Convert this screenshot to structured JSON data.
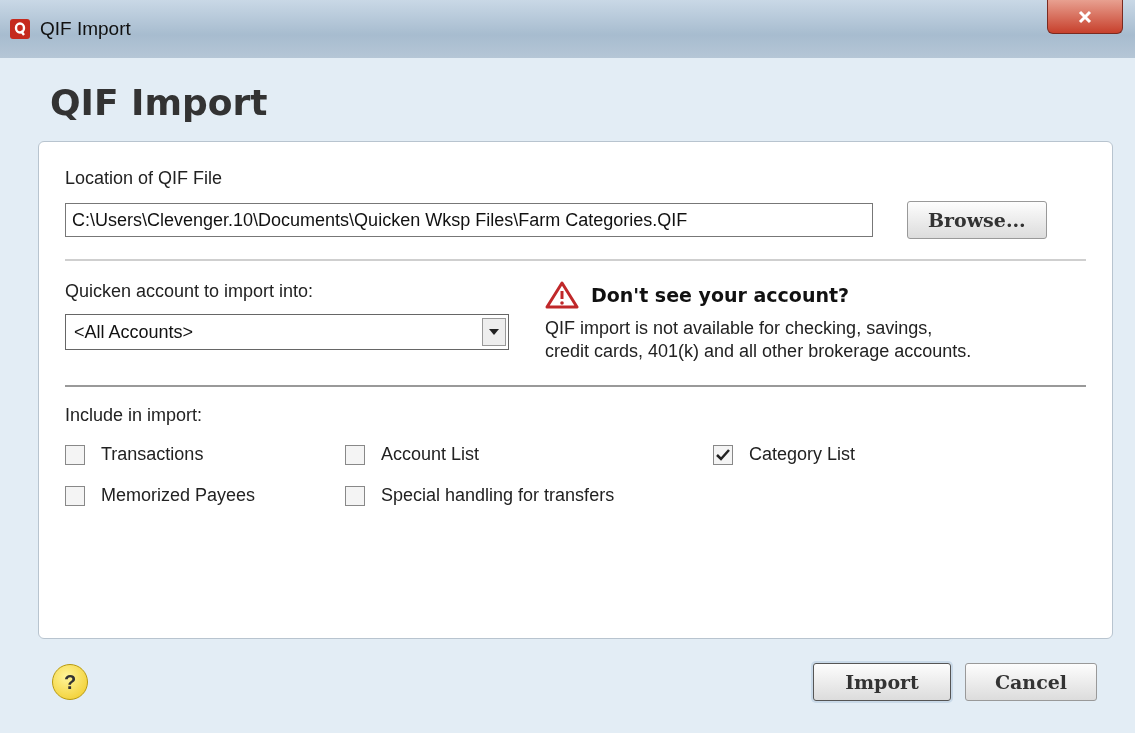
{
  "window": {
    "title": "QIF Import"
  },
  "heading": "QIF Import",
  "file_location": {
    "label": "Location of QIF File",
    "value": "C:\\Users\\Clevenger.10\\Documents\\Quicken Wksp Files\\Farm Categories.QIF",
    "browse_button": "Browse..."
  },
  "account": {
    "label": "Quicken account to import into:",
    "value": "<All Accounts>"
  },
  "warning": {
    "title": "Don't see your account?",
    "text": "QIF import is not available for checking, savings, credit cards, 401(k) and all other brokerage accounts."
  },
  "include": {
    "label": "Include in import:",
    "options": [
      {
        "label": "Transactions",
        "checked": false
      },
      {
        "label": "Account List",
        "checked": false
      },
      {
        "label": "Category List",
        "checked": true
      },
      {
        "label": "Memorized Payees",
        "checked": false
      },
      {
        "label": "Special handling for transfers",
        "checked": false
      }
    ]
  },
  "help": "?",
  "buttons": [
    {
      "label": "Import",
      "default": true
    },
    {
      "label": "Cancel",
      "default": false
    }
  ]
}
